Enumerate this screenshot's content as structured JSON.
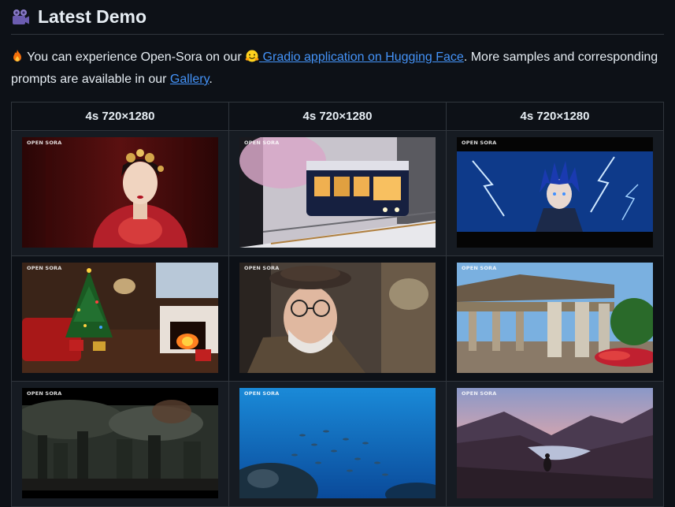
{
  "heading": {
    "title": "Latest Demo",
    "icon": "film-camera-icon"
  },
  "intro": {
    "text_1": "You can experience Open-Sora on our",
    "link_1": "Gradio application on Hugging Face",
    "text_2": ". More samples and corresponding prompts are available in our",
    "link_2": "Gallery",
    "text_3": ".",
    "lead_icon": "fire-icon",
    "link_icon": "hugging-face-icon"
  },
  "table": {
    "headers": [
      "4s 720×1280",
      "4s 720×1280",
      "4s 720×1280"
    ],
    "watermark": "OPEN SORA",
    "rows": [
      [
        {
          "name": "woman-in-red-costume"
        },
        {
          "name": "tram-in-snow"
        },
        {
          "name": "anime-lightning-warrior"
        }
      ],
      [
        {
          "name": "christmas-living-room"
        },
        {
          "name": "old-man-with-glasses"
        },
        {
          "name": "ancient-temple-ruins"
        }
      ],
      [
        {
          "name": "smoky-ruined-city"
        },
        {
          "name": "underwater-fish"
        },
        {
          "name": "mountain-lake-sunset"
        }
      ]
    ]
  },
  "colors": {
    "link": "#4493f8",
    "bg": "#0d1117",
    "border": "#30363d"
  }
}
